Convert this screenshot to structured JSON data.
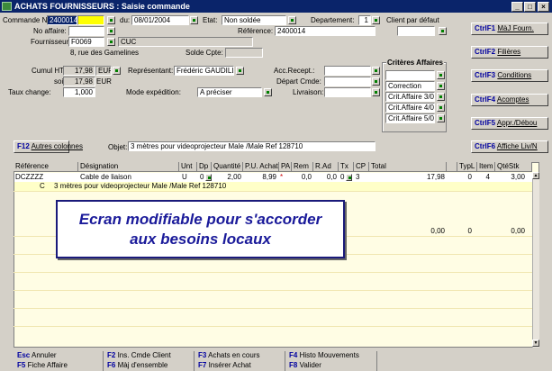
{
  "window": {
    "title": "ACHATS FOURNISSEURS : Saisie commande",
    "min_glyph": "_",
    "max_glyph": "□",
    "close_glyph": "×"
  },
  "header": {
    "commande_label": "Commande No:",
    "commande_value": "2400014",
    "commande_suffix": "",
    "du_label": "du:",
    "date_value": "08/01/2004",
    "etat_label": "Etat:",
    "etat_value": "Non soldée",
    "departement_label": "Departement:",
    "departement_value": "1",
    "client_label": "Client par défaut",
    "no_affaire_label": "No affaire:",
    "reference_label": "Référence:",
    "reference_value": "2400014",
    "fournisseur_label": "Fournisseur:",
    "fournisseur_code": "F0069",
    "fournisseur_name": "CUC",
    "address": "8, rue des Gamelines",
    "solde_label": "Solde Cpte:",
    "cumul_label": "Cumul HT:",
    "cumul_value": "17,98",
    "cumul_currency": "EUR",
    "soit_label": "soit:",
    "soit_value": "17,98",
    "soit_currency": "EUR",
    "taux_label": "Taux change:",
    "taux_value": "1,000",
    "representant_label": "Représentant:",
    "representant_value": "Frédéric GAUDILL",
    "mode_label": "Mode expédition:",
    "mode_value": "A préciser",
    "acc_label": "Acc.Recept.:",
    "depart_label": "Départ Cmde:",
    "livraison_label": "Livraison:"
  },
  "criteres": {
    "title": "Critères Affaires",
    "items": [
      "",
      "Correction",
      "Crit.Affaire 3/0",
      "Crit.Affaire 4/0",
      "Crit.Affaire 5/0"
    ]
  },
  "nav_buttons": [
    {
      "key": "CtrlF1",
      "label": "MàJ Fourn."
    },
    {
      "key": "CtrlF2",
      "label": "Filières"
    },
    {
      "key": "CtrlF3",
      "label": "Conditions"
    },
    {
      "key": "CtrlF4",
      "label": "Acomptes"
    },
    {
      "key": "CtrlF5",
      "label": "Appr./Débou"
    },
    {
      "key": "CtrlF6",
      "label": "Affiche Liv/N"
    }
  ],
  "autres": {
    "key": "F12",
    "label": "Autres colonnes"
  },
  "objet": {
    "label": "Objet:",
    "value": "3 mètres pour videoprojecteur Male /Male Ref 128710"
  },
  "grid": {
    "columns": [
      "Référence",
      "Désignation",
      "Unt",
      "Dp",
      "Quantité",
      "P.U. Achat",
      "PA",
      "Rem",
      "R.Ad",
      "Tx",
      "CP",
      "Total",
      "TypL",
      "Item",
      "QtéStk"
    ],
    "row1": {
      "reference": "DCZZZZ",
      "designation": "Cable de liaison",
      "unt": "U",
      "dp": "0",
      "quantite": "2,00",
      "pu": "8,99",
      "pa": "*",
      "rem": "0,0",
      "rad": "0,0",
      "tx": "0",
      "cp": "3",
      "total": "17,98",
      "typl": "0",
      "item": "4",
      "qtestk": "3,00"
    },
    "row2": {
      "code": "C",
      "text": "3 mètres pour videoprojecteur Male /Male Ref 128710"
    },
    "row3": {
      "total": "0,00",
      "typl": "0",
      "qtestk": "0,00"
    }
  },
  "overlay": {
    "line1": "Ecran modifiable pour s'accorder",
    "line2": "aux besoins locaux"
  },
  "fkeys_row1": [
    {
      "key": "Esc",
      "label": "Annuler"
    },
    {
      "key": "F2",
      "label": "Ins. Cmde Client"
    },
    {
      "key": "F3",
      "label": "Achats en cours"
    },
    {
      "key": "F4",
      "label": "Histo Mouvements"
    }
  ],
  "fkeys_row2": [
    {
      "key": "F5",
      "label": "Fiche Affaire"
    },
    {
      "key": "F6",
      "label": "Màj d'ensemble"
    },
    {
      "key": "F7",
      "label": "Insérer Achat"
    },
    {
      "key": "F8",
      "label": "Valider"
    }
  ],
  "colors": {
    "title_bar": "#0a246a",
    "window_bg": "#d4d0c8",
    "grid_bg": "#fffde4",
    "highlight": "#ffff00",
    "key_blue": "#0000a0",
    "overlay_text": "#1a1a9a"
  }
}
